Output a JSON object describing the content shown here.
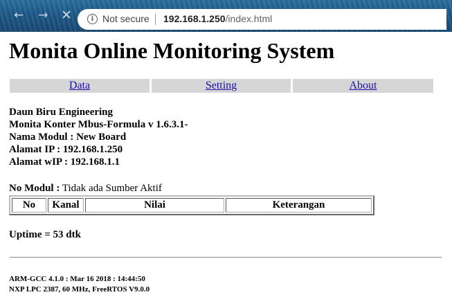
{
  "browser": {
    "security_label": "Not secure",
    "url_host": "192.168.1.250",
    "url_path": "/index.html"
  },
  "page": {
    "title": "Monita Online Monitoring System",
    "menu": [
      {
        "label": "Data"
      },
      {
        "label": "Setting"
      },
      {
        "label": "About"
      }
    ],
    "info_lines": [
      "Daun Biru Engineering",
      "Monita Konter Mbus-Formula v 1.6.3.1-",
      "Nama Modul : New Board",
      "Alamat IP : 192.168.1.250",
      "Alamat wIP : 192.168.1.1"
    ],
    "no_modul_label": "No Modul :",
    "no_modul_value": "Tidak ada Sumber Aktif",
    "table_headers": [
      "No",
      "Kanal",
      "Nilai",
      "Keterangan"
    ],
    "uptime": "Uptime = 53 dtk",
    "footer_lines": [
      "ARM-GCC 4.1.0 : Mar 16 2018 : 14:44:50",
      "NXP LPC 2387, 60 MHz, FreeRTOS V9.0.0"
    ]
  }
}
